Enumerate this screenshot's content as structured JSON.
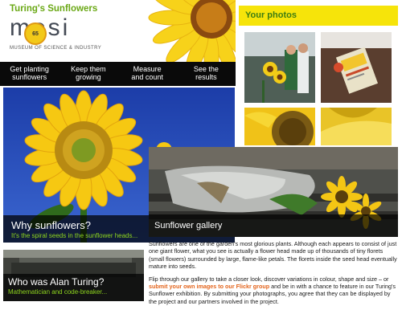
{
  "header": {
    "site_title": "Turing's Sunflowers",
    "logo_word": "mosi",
    "badge_text": "65",
    "museum_caption": "MUSEUM OF SCIENCE & INDUSTRY"
  },
  "nav": {
    "items": [
      {
        "line1": "Get planting",
        "line2": "sunflowers"
      },
      {
        "line1": "Keep them",
        "line2": "growing"
      },
      {
        "line1": "Measure",
        "line2": "and count"
      },
      {
        "line1": "See the",
        "line2": "results"
      }
    ]
  },
  "photos": {
    "title": "Your photos"
  },
  "why_panel": {
    "title": "Why sunflowers?",
    "subtitle": "It's the spiral seeds in the sunflower heads..."
  },
  "gallery_panel": {
    "title": "Sunflower gallery"
  },
  "body": {
    "para1": "Sunflowers are one of the garden's most glorious plants. Although each appears to consist of just one giant flower, what you see is actually a flower head made up of thousands of tiny florets (small flowers) surrounded by large, flame-like petals. The florets inside the seed head eventually mature into seeds.",
    "para2_start": "Flip through our gallery to take a closer look, discover variations in colour, shape and size – or ",
    "para2_link": "submit your own images to our Flickr group",
    "para2_end": " and be in with a chance to feature in our Turing's Sunflower exhibition. By submitting your photographs, you agree that they can be displayed by the project and our partners involved in the project."
  },
  "turing_panel": {
    "title": "Who was Alan Turing?",
    "subtitle": "Mathematician and code-breaker..."
  },
  "colors": {
    "accent_green": "#6aa815",
    "link_orange": "#e3641c",
    "photos_yellow": "#f6e40a",
    "nav_black": "#0a0a0a"
  }
}
